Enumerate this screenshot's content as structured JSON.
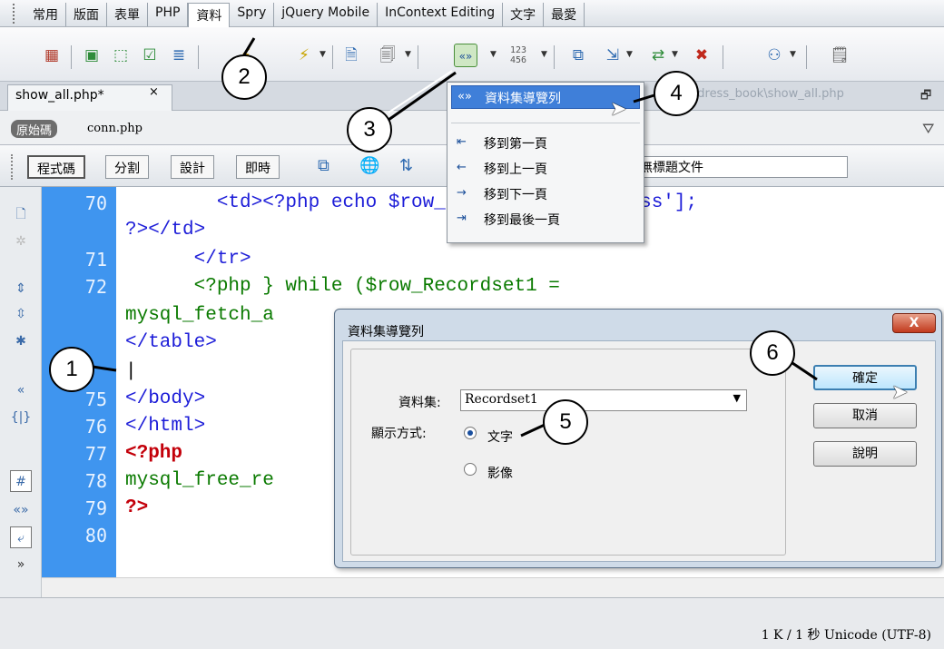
{
  "insert_tabs": [
    "常用",
    "版面",
    "表單",
    "PHP",
    "資料",
    "Spry",
    "jQuery Mobile",
    "InContext Editing",
    "文字",
    "最愛"
  ],
  "active_tab": "資料",
  "document": {
    "tab_label": "show_all.php*",
    "close_glyph": "×",
    "path": "ddress_book\\show_all.php"
  },
  "related": {
    "source_button": "原始碼",
    "file": "conn.php"
  },
  "doc_toolbar": {
    "views": [
      "程式碼",
      "分割",
      "設計",
      "即時"
    ],
    "title_value": "無標題文件"
  },
  "toolbar_numbers": "123 456",
  "code_lines": [
    {
      "num": "70",
      "text": "        <td><?php echo $row_Recordset1['address'];"
    },
    {
      "num": "",
      "text": "?></td>"
    },
    {
      "num": "71",
      "text": "      </tr>"
    },
    {
      "num": "72",
      "text": "      <?php } while ($row_Recordset1 ="
    },
    {
      "num": "",
      "text": "mysql_fetch_a"
    },
    {
      "num": "",
      "text": "</table>"
    },
    {
      "num": "",
      "text": "|"
    },
    {
      "num": "75",
      "text": "</body>"
    },
    {
      "num": "76",
      "text": "</html>"
    },
    {
      "num": "77",
      "text": "<?php"
    },
    {
      "num": "78",
      "text": "mysql_free_re"
    },
    {
      "num": "79",
      "text": "?>"
    },
    {
      "num": "80",
      "text": ""
    }
  ],
  "menu": {
    "items": [
      {
        "label": "資料集導覽列",
        "icon": "recordset-nav-icon"
      },
      {
        "label": "移到第一頁",
        "icon": "move-first-icon"
      },
      {
        "label": "移到上一頁",
        "icon": "move-prev-icon"
      },
      {
        "label": "移到下一頁",
        "icon": "move-next-icon"
      },
      {
        "label": "移到最後一頁",
        "icon": "move-last-icon"
      }
    ]
  },
  "dialog": {
    "title": "資料集導覽列",
    "close_label": "X",
    "recordset_label": "資料集:",
    "recordset_value": "Recordset1",
    "display_label": "顯示方式:",
    "option_text": "文字",
    "option_image": "影像",
    "selected_option": "文字",
    "ok": "確定",
    "cancel": "取消",
    "help": "說明"
  },
  "status": "1 K / 1 秒 Unicode (UTF-8)",
  "callouts": [
    "1",
    "2",
    "3",
    "4",
    "5",
    "6"
  ]
}
